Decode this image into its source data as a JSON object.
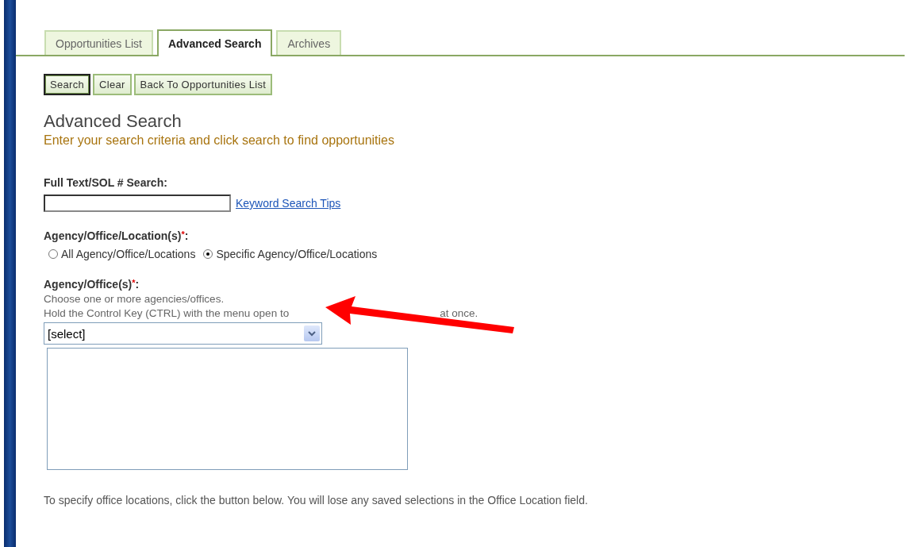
{
  "tabs": [
    {
      "label": "Opportunities List",
      "selected": false
    },
    {
      "label": "Advanced Search",
      "selected": true
    },
    {
      "label": "Archives",
      "selected": false
    }
  ],
  "toolbar": [
    {
      "label": "Search",
      "selected": true
    },
    {
      "label": "Clear",
      "selected": false
    },
    {
      "label": "Back To Opportunities List",
      "selected": false
    }
  ],
  "heading": "Advanced Search",
  "subheading": "Enter your search criteria and click search to find opportunities",
  "full_text": {
    "label": "Full Text/SOL # Search:",
    "link": "Keyword Search Tips"
  },
  "location": {
    "label": "Agency/Office/Location(s)",
    "required_mark": "*",
    "colon": ":",
    "options": [
      {
        "label": "All Agency/Office/Locations",
        "selected": false
      },
      {
        "label": "Specific Agency/Office/Locations",
        "selected": true
      }
    ]
  },
  "agency": {
    "label": "Agency/Office(s)",
    "required_mark": "*",
    "colon": ":",
    "hint": "Choose one or more agencies/offices.",
    "hint2_start": "Hold the Control Key (CTRL) with the menu open to",
    "hint2_end": "at once.",
    "dropdown": "[select]"
  },
  "footer_note": "To specify office locations, click the button below. You will lose any saved selections in the Office Location field."
}
